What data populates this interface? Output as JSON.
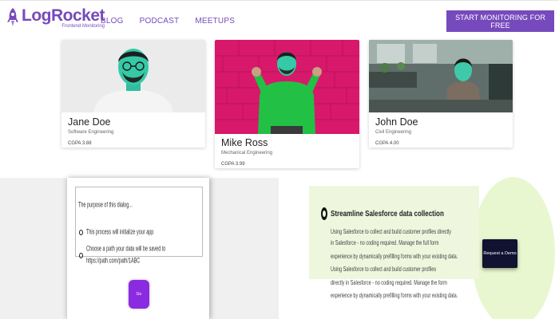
{
  "header": {
    "brand": "LogRocket",
    "tagline": "Frontend Monitoring",
    "nav": [
      "BLOG",
      "PODCAST",
      "MEETUPS"
    ],
    "cta_label": "START MONITORING FOR FREE"
  },
  "cards": [
    {
      "name": "Jane Doe",
      "department": "Software Engineering",
      "gpa": "CGPA 3.88"
    },
    {
      "name": "Mike Ross",
      "department": "Mechanical Engineering",
      "gpa": "CGPA 3.99"
    },
    {
      "name": "John Doe",
      "department": "Civil Engineering",
      "gpa": "CGPA 4.00"
    }
  ],
  "dialog": {
    "line1": "The purpose of this dialog...",
    "option1": "This process will initialize your app",
    "option2": "Choose a path your data will be saved to",
    "option3": "https://path.com/path/1ABC",
    "button_label": "Go"
  },
  "ad": {
    "title": "Streamline Salesforce data collection",
    "lines": [
      "Using Salesforce to collect and build customer profiles directly",
      "in Salesforce - no coding required. Manage the full form",
      "experience by dynamically prefilling forms with your existing data.",
      "Using Salesforce to collect and build customer profiles",
      "directly in Salesforce - no coding required. Manage the form",
      "experience by dynamically prefilling forms with your existing data."
    ],
    "button_label": "Request a Demo"
  },
  "colors": {
    "brand": "#764abc",
    "ad_background": "#eef7de",
    "demo_button": "#0f1230",
    "dialog_button": "#8a2be2"
  }
}
